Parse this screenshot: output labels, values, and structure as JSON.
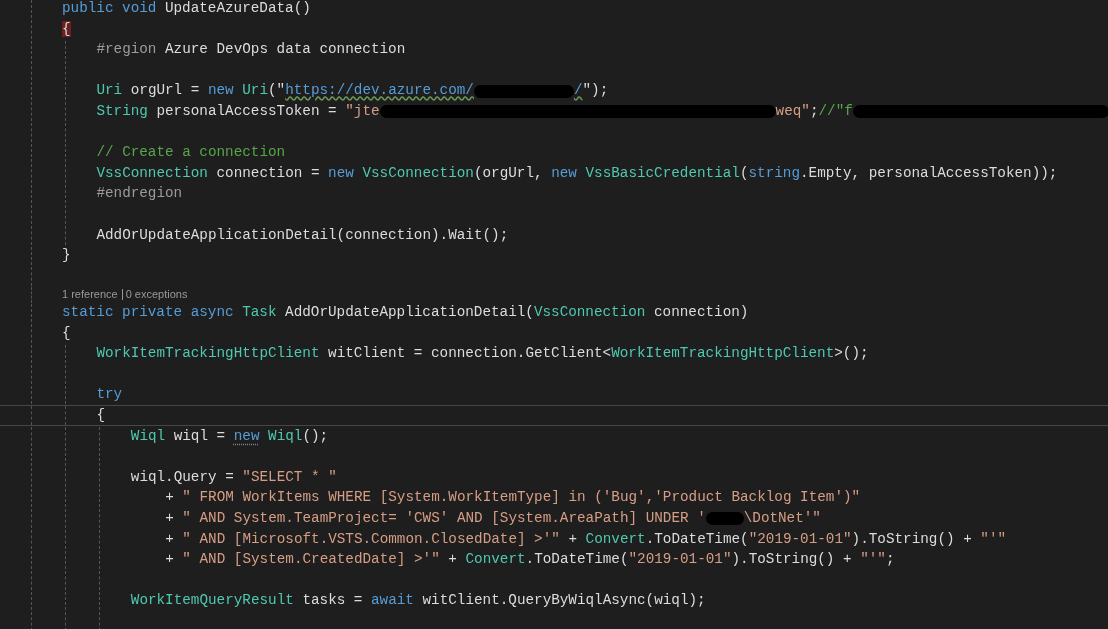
{
  "editor": {
    "lines": [
      {
        "kind": "code",
        "current": false,
        "tokens": [
          {
            "kind": "kw",
            "text": "public void"
          },
          {
            "kind": "plain",
            "text": " UpdateAzureData()"
          }
        ]
      },
      {
        "kind": "code",
        "current": false,
        "guide": true,
        "tokens": [
          {
            "kind": "brace-match",
            "text": "{"
          }
        ],
        "children": [
          {
            "kind": "code",
            "current": false,
            "tokens": [
              {
                "kind": "pre",
                "text": "#region"
              },
              {
                "kind": "plain",
                "text": " Azure DevOps data connection"
              }
            ]
          },
          {
            "kind": "blank",
            "current": false
          },
          {
            "kind": "code",
            "current": false,
            "tokens": [
              {
                "kind": "type",
                "text": "Uri"
              },
              {
                "kind": "plain",
                "text": " orgUrl = "
              },
              {
                "kind": "kw",
                "text": "new "
              },
              {
                "kind": "type",
                "text": "Uri"
              },
              {
                "kind": "plain",
                "text": "(\""
              },
              {
                "kind": "url",
                "text": "https://dev.azure.com/"
              },
              {
                "kind": "redaction"
              },
              {
                "kind": "url",
                "text": "/"
              },
              {
                "kind": "plain",
                "text": "\");"
              }
            ]
          },
          {
            "kind": "code",
            "current": false,
            "tokens": [
              {
                "kind": "type",
                "text": "String"
              },
              {
                "kind": "plain",
                "text": " personalAccessToken = "
              },
              {
                "kind": "str",
                "text": "\"jte"
              },
              {
                "kind": "redaction"
              },
              {
                "kind": "str",
                "text": "weq\""
              },
              {
                "kind": "plain",
                "text": ";"
              },
              {
                "kind": "comment",
                "text": "//\"f"
              },
              {
                "kind": "redaction"
              }
            ]
          },
          {
            "kind": "blank",
            "current": false
          },
          {
            "kind": "code",
            "current": false,
            "tokens": [
              {
                "kind": "comment",
                "text": "// Create a connection"
              }
            ]
          },
          {
            "kind": "code",
            "current": false,
            "tokens": [
              {
                "kind": "type",
                "text": "VssConnection"
              },
              {
                "kind": "plain",
                "text": " connection = "
              },
              {
                "kind": "kw",
                "text": "new "
              },
              {
                "kind": "type",
                "text": "VssConnection"
              },
              {
                "kind": "plain",
                "text": "(orgUrl, "
              },
              {
                "kind": "kw",
                "text": "new "
              },
              {
                "kind": "type",
                "text": "VssBasicCredential"
              },
              {
                "kind": "plain",
                "text": "("
              },
              {
                "kind": "kw",
                "text": "string"
              },
              {
                "kind": "plain",
                "text": ".Empty, personalAccessToken));"
              }
            ]
          },
          {
            "kind": "code",
            "current": false,
            "tokens": [
              {
                "kind": "pre",
                "text": "#endregion"
              }
            ]
          },
          {
            "kind": "blank",
            "current": false
          },
          {
            "kind": "code",
            "current": false,
            "tokens": [
              {
                "kind": "plain",
                "text": "AddOrUpdateApplicationDetail(connection).Wait();"
              }
            ]
          }
        ]
      },
      {
        "kind": "code",
        "current": false,
        "tokens": [
          {
            "kind": "plain",
            "text": "}"
          }
        ]
      },
      {
        "kind": "blank",
        "current": false
      },
      {
        "kind": "codelens",
        "items": [
          "1 reference",
          "0 exceptions"
        ]
      },
      {
        "kind": "code",
        "current": false,
        "tokens": [
          {
            "kind": "kw",
            "text": "static private async "
          },
          {
            "kind": "type",
            "text": "Task"
          },
          {
            "kind": "plain",
            "text": " AddOrUpdateApplicationDetail("
          },
          {
            "kind": "type",
            "text": "VssConnection"
          },
          {
            "kind": "plain",
            "text": " connection)"
          }
        ]
      },
      {
        "kind": "code",
        "current": false,
        "guide": true,
        "tokens": [
          {
            "kind": "plain",
            "text": "{"
          }
        ],
        "children": [
          {
            "kind": "code",
            "current": false,
            "tokens": [
              {
                "kind": "type",
                "text": "WorkItemTrackingHttpClient"
              },
              {
                "kind": "plain",
                "text": " witClient = connection.GetClient<"
              },
              {
                "kind": "type",
                "text": "WorkItemTrackingHttpClient"
              },
              {
                "kind": "plain",
                "text": ">();"
              }
            ]
          },
          {
            "kind": "blank",
            "current": false
          },
          {
            "kind": "code",
            "current": false,
            "tokens": [
              {
                "kind": "kw",
                "text": "try"
              }
            ]
          },
          {
            "kind": "code",
            "current": true,
            "guide": true,
            "tokens": [
              {
                "kind": "plain",
                "text": "{"
              }
            ],
            "children": [
              {
                "kind": "code",
                "current": false,
                "tokens": [
                  {
                    "kind": "type",
                    "text": "Wiql"
                  },
                  {
                    "kind": "plain",
                    "text": " wiql = "
                  },
                  {
                    "kind": "hint",
                    "text": "new"
                  },
                  {
                    "kind": "type",
                    "text": " Wiql"
                  },
                  {
                    "kind": "plain",
                    "text": "();"
                  }
                ]
              },
              {
                "kind": "blank",
                "current": false
              },
              {
                "kind": "code",
                "current": false,
                "guide": false,
                "tokens": [
                  {
                    "kind": "plain",
                    "text": "wiql.Query = "
                  },
                  {
                    "kind": "str",
                    "text": "\"SELECT * \""
                  }
                ],
                "children": [
                  {
                    "kind": "code",
                    "current": false,
                    "tokens": [
                      {
                        "kind": "plain",
                        "text": "+ "
                      },
                      {
                        "kind": "str",
                        "text": "\" FROM WorkItems WHERE [System.WorkItemType] in ('Bug','Product Backlog Item')\""
                      }
                    ]
                  },
                  {
                    "kind": "code",
                    "current": false,
                    "tokens": [
                      {
                        "kind": "plain",
                        "text": "+ "
                      },
                      {
                        "kind": "str",
                        "text": "\" AND System.TeamProject= 'CWS' AND [System.AreaPath] UNDER '"
                      },
                      {
                        "kind": "redaction"
                      },
                      {
                        "kind": "str",
                        "text": "\\DotNet'\""
                      }
                    ]
                  },
                  {
                    "kind": "code",
                    "current": false,
                    "tokens": [
                      {
                        "kind": "plain",
                        "text": "+ "
                      },
                      {
                        "kind": "str",
                        "text": "\" AND [Microsoft.VSTS.Common.ClosedDate] >'\""
                      },
                      {
                        "kind": "plain",
                        "text": " + "
                      },
                      {
                        "kind": "type",
                        "text": "Convert"
                      },
                      {
                        "kind": "plain",
                        "text": ".ToDateTime("
                      },
                      {
                        "kind": "str",
                        "text": "\"2019-01-01\""
                      },
                      {
                        "kind": "plain",
                        "text": ").ToString() + "
                      },
                      {
                        "kind": "str",
                        "text": "\"'\""
                      }
                    ]
                  },
                  {
                    "kind": "code",
                    "current": false,
                    "tokens": [
                      {
                        "kind": "plain",
                        "text": "+ "
                      },
                      {
                        "kind": "str",
                        "text": "\" AND [System.CreatedDate] >'\""
                      },
                      {
                        "kind": "plain",
                        "text": " + "
                      },
                      {
                        "kind": "type",
                        "text": "Convert"
                      },
                      {
                        "kind": "plain",
                        "text": ".ToDateTime("
                      },
                      {
                        "kind": "str",
                        "text": "\"2019-01-01\""
                      },
                      {
                        "kind": "plain",
                        "text": ").ToString() + "
                      },
                      {
                        "kind": "str",
                        "text": "\"'\""
                      },
                      {
                        "kind": "plain",
                        "text": ";"
                      }
                    ]
                  }
                ]
              },
              {
                "kind": "blank",
                "current": false
              },
              {
                "kind": "code",
                "current": false,
                "tokens": [
                  {
                    "kind": "type",
                    "text": "WorkItemQueryResult"
                  },
                  {
                    "kind": "plain",
                    "text": " tasks = "
                  },
                  {
                    "kind": "kw",
                    "text": "await"
                  },
                  {
                    "kind": "plain",
                    "text": " witClient.QueryByWiqlAsync(wiql);"
                  }
                ]
              },
              {
                "kind": "blank",
                "current": false
              }
            ]
          }
        ]
      }
    ]
  }
}
